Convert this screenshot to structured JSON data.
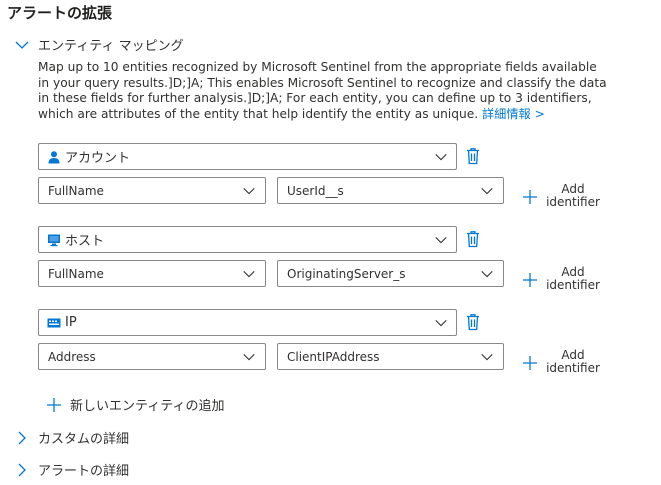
{
  "section": {
    "title": "アラートの拡張"
  },
  "entity_mapping": {
    "label": "エンティティ マッピング",
    "expanded": true,
    "description": "Map up to 10 entities recognized by Microsoft Sentinel from the appropriate fields available in your query results.]D;]A; This enables Microsoft Sentinel to recognize and classify the data in these fields for further analysis.]D;]A; For each entity, you can define up to 3 identifiers, which are attributes of the entity that help identify the entity as unique.",
    "learn_more": "詳細情報 >",
    "entities": [
      {
        "type": "アカウント",
        "icon": "account-icon",
        "identifier": "FullName",
        "column": "UserId__s"
      },
      {
        "type": "ホスト",
        "icon": "host-icon",
        "identifier": "FullName",
        "column": "OriginatingServer_s"
      },
      {
        "type": "IP",
        "icon": "ip-icon",
        "identifier": "Address",
        "column": "ClientIPAddress"
      }
    ],
    "add_identifier_line1": "Add",
    "add_identifier_line2": "identifier",
    "add_entity_label": "新しいエンティティの追加"
  },
  "custom_details": {
    "label": "カスタムの詳細",
    "expanded": false
  },
  "alert_details": {
    "label": "アラートの詳細",
    "expanded": false
  },
  "colors": {
    "accent": "#0078d4",
    "icon_blue": "#0078d4",
    "border": "#8a8886",
    "text": "#323130"
  }
}
